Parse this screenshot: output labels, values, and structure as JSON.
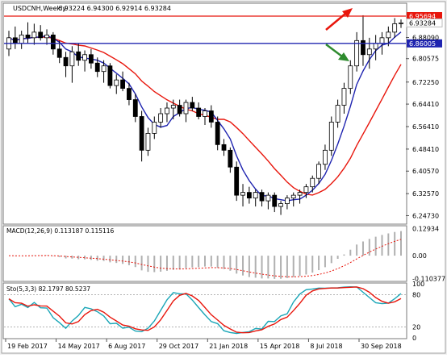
{
  "chart_data": {
    "type": "candlestick",
    "symbol_header": "USDCNH,Weekly",
    "ohlc_header": "6.93224 6.94300 6.92914 6.93284",
    "price_axis": {
      "ticks": [
        "6.88090",
        "6.80575",
        "6.72250",
        "6.64410",
        "6.56410",
        "6.48410",
        "6.40570",
        "6.32570",
        "6.24730"
      ],
      "range": [
        6.22,
        7.0
      ]
    },
    "horizontal_lines": [
      {
        "value": 6.95694,
        "label": "6.95694",
        "color": "#e8160c"
      },
      {
        "value": 6.86005,
        "label": "6.86005",
        "color": "#1f24b0"
      }
    ],
    "current_price_label": "6.93284",
    "candles": [
      [
        6.84,
        6.905,
        6.815,
        6.88
      ],
      [
        6.88,
        6.92,
        6.84,
        6.86
      ],
      [
        6.86,
        6.905,
        6.84,
        6.89
      ],
      [
        6.89,
        6.935,
        6.86,
        6.88
      ],
      [
        6.88,
        6.93,
        6.855,
        6.9
      ],
      [
        6.9,
        6.925,
        6.87,
        6.88
      ],
      [
        6.88,
        6.91,
        6.855,
        6.89
      ],
      [
        6.89,
        6.9,
        6.82,
        6.84
      ],
      [
        6.84,
        6.87,
        6.79,
        6.81
      ],
      [
        6.81,
        6.83,
        6.74,
        6.78
      ],
      [
        6.78,
        6.85,
        6.72,
        6.83
      ],
      [
        6.83,
        6.86,
        6.78,
        6.8
      ],
      [
        6.8,
        6.835,
        6.76,
        6.82
      ],
      [
        6.82,
        6.84,
        6.77,
        6.79
      ],
      [
        6.79,
        6.81,
        6.74,
        6.76
      ],
      [
        6.76,
        6.8,
        6.72,
        6.78
      ],
      [
        6.78,
        6.79,
        6.7,
        6.71
      ],
      [
        6.71,
        6.75,
        6.68,
        6.73
      ],
      [
        6.73,
        6.76,
        6.69,
        6.7
      ],
      [
        6.7,
        6.72,
        6.64,
        6.66
      ],
      [
        6.66,
        6.68,
        6.58,
        6.6
      ],
      [
        6.6,
        6.62,
        6.44,
        6.48
      ],
      [
        6.48,
        6.56,
        6.46,
        6.54
      ],
      [
        6.54,
        6.6,
        6.52,
        6.58
      ],
      [
        6.58,
        6.63,
        6.56,
        6.61
      ],
      [
        6.61,
        6.65,
        6.58,
        6.63
      ],
      [
        6.63,
        6.66,
        6.59,
        6.64
      ],
      [
        6.64,
        6.66,
        6.6,
        6.61
      ],
      [
        6.61,
        6.66,
        6.58,
        6.65
      ],
      [
        6.65,
        6.67,
        6.62,
        6.63
      ],
      [
        6.63,
        6.65,
        6.59,
        6.6
      ],
      [
        6.6,
        6.63,
        6.57,
        6.62
      ],
      [
        6.62,
        6.64,
        6.56,
        6.58
      ],
      [
        6.58,
        6.6,
        6.48,
        6.5
      ],
      [
        6.5,
        6.52,
        6.46,
        6.48
      ],
      [
        6.48,
        6.49,
        6.4,
        6.42
      ],
      [
        6.42,
        6.44,
        6.3,
        6.32
      ],
      [
        6.32,
        6.36,
        6.28,
        6.33
      ],
      [
        6.33,
        6.35,
        6.29,
        6.31
      ],
      [
        6.31,
        6.34,
        6.28,
        6.33
      ],
      [
        6.33,
        6.34,
        6.28,
        6.3
      ],
      [
        6.3,
        6.33,
        6.27,
        6.32
      ],
      [
        6.32,
        6.33,
        6.26,
        6.28
      ],
      [
        6.28,
        6.3,
        6.25,
        6.29
      ],
      [
        6.29,
        6.32,
        6.27,
        6.31
      ],
      [
        6.31,
        6.33,
        6.28,
        6.32
      ],
      [
        6.32,
        6.34,
        6.29,
        6.33
      ],
      [
        6.33,
        6.36,
        6.31,
        6.35
      ],
      [
        6.35,
        6.39,
        6.33,
        6.38
      ],
      [
        6.38,
        6.44,
        6.36,
        6.43
      ],
      [
        6.43,
        6.5,
        6.41,
        6.48
      ],
      [
        6.48,
        6.6,
        6.46,
        6.58
      ],
      [
        6.58,
        6.66,
        6.56,
        6.64
      ],
      [
        6.64,
        6.72,
        6.61,
        6.7
      ],
      [
        6.7,
        6.8,
        6.68,
        6.78
      ],
      [
        6.78,
        6.9,
        6.76,
        6.87
      ],
      [
        6.87,
        6.96,
        6.78,
        6.82
      ],
      [
        6.82,
        6.88,
        6.77,
        6.84
      ],
      [
        6.84,
        6.89,
        6.8,
        6.86
      ],
      [
        6.86,
        6.9,
        6.82,
        6.88
      ],
      [
        6.88,
        6.92,
        6.85,
        6.9
      ],
      [
        6.9,
        6.95,
        6.88,
        6.93
      ],
      [
        6.93,
        6.945,
        6.915,
        6.933
      ]
    ],
    "x_axis_labels": [
      "19 Feb 2017",
      "14 May 2017",
      "6 Aug 2017",
      "29 Oct 2017",
      "21 Jan 2018",
      "15 Apr 2018",
      "8 Jul 2018",
      "30 Sep 2018"
    ],
    "macd": {
      "label": "MACD(12,26,9) 0.113187 0.115116",
      "ticks": [
        "0.12934",
        "0.00",
        "-0.110377"
      ],
      "range": [
        -0.12,
        0.14
      ]
    },
    "stoch": {
      "label": "Sto(5,3,3) 82.1797 80.5237",
      "ticks": [
        "100",
        "80",
        "20",
        "0"
      ],
      "range": [
        0,
        100
      ]
    },
    "colors": {
      "ma_fast": "#1f24b0",
      "ma_slow": "#e8160c",
      "stoch_main": "#1aa6b7",
      "stoch_signal": "#e8160c",
      "arrow_up": "#e8160c",
      "arrow_down": "#2e8b2e"
    }
  }
}
